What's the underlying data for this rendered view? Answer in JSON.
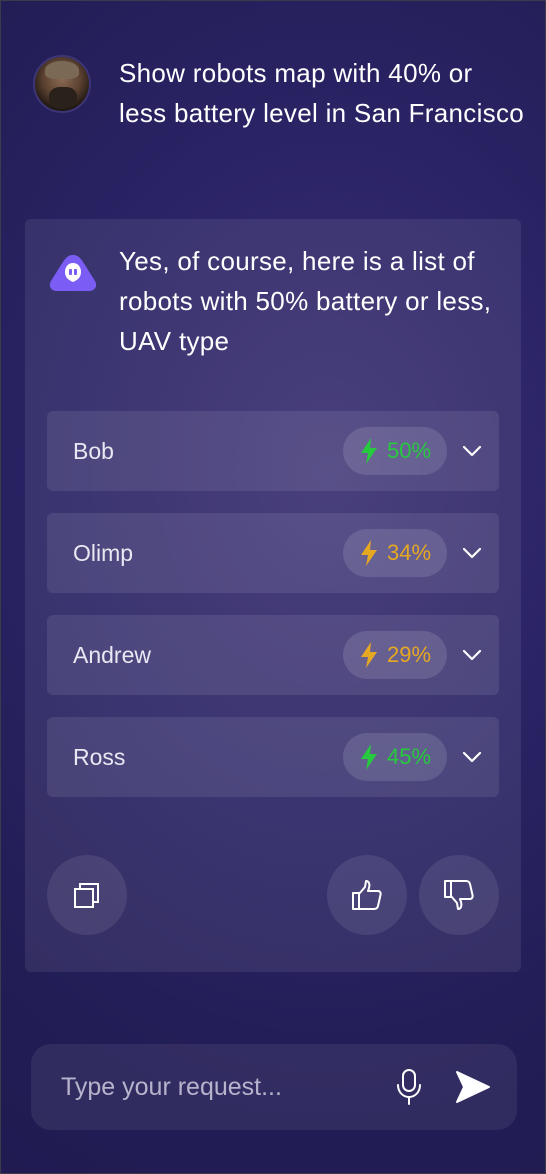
{
  "chat": {
    "user_message": "Show robots map with 40% or less battery level in San Francisco",
    "bot_message": "Yes, of course, here is a list of robots with 50% battery or less, UAV type"
  },
  "robots": [
    {
      "name": "Bob",
      "battery": "50%",
      "battery_value": 50,
      "status_color": "#27c93f"
    },
    {
      "name": "Olimp",
      "battery": "34%",
      "battery_value": 34,
      "status_color": "#e6a823"
    },
    {
      "name": "Andrew",
      "battery": "29%",
      "battery_value": 29,
      "status_color": "#e6a823"
    },
    {
      "name": "Ross",
      "battery": "45%",
      "battery_value": 45,
      "status_color": "#27c93f"
    }
  ],
  "actions": {
    "copy_icon": "copy-icon",
    "like_icon": "thumbs-up-icon",
    "dislike_icon": "thumbs-down-icon"
  },
  "input": {
    "placeholder": "Type your request...",
    "value": "",
    "mic_icon": "microphone-icon",
    "send_icon": "send-icon"
  },
  "colors": {
    "accent": "#7b5cf5",
    "battery_ok": "#27c93f",
    "battery_low": "#e6a823",
    "background": "#2b2466"
  }
}
